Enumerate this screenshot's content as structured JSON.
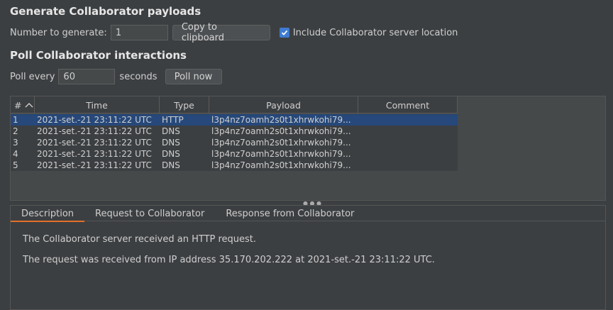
{
  "generate": {
    "title": "Generate Collaborator payloads",
    "number_label": "Number to generate:",
    "number_value": "1",
    "copy_button": "Copy to clipboard",
    "include_label": "Include Collaborator server location",
    "include_checked": true
  },
  "poll": {
    "title": "Poll Collaborator interactions",
    "poll_every_label": "Poll every",
    "poll_value": "60",
    "seconds_label": "seconds",
    "poll_now_button": "Poll now"
  },
  "table": {
    "columns": [
      "#",
      "Time",
      "Type",
      "Payload",
      "Comment"
    ],
    "sort_indicator": "^",
    "rows": [
      {
        "num": "1",
        "time": "2021-set.-21 23:11:22 UTC",
        "type": "HTTP",
        "payload": "l3p4nz7oamh2s0t1xhrwkohi79...",
        "comment": ""
      },
      {
        "num": "2",
        "time": "2021-set.-21 23:11:22 UTC",
        "type": "DNS",
        "payload": "l3p4nz7oamh2s0t1xhrwkohi79...",
        "comment": ""
      },
      {
        "num": "3",
        "time": "2021-set.-21 23:11:22 UTC",
        "type": "DNS",
        "payload": "l3p4nz7oamh2s0t1xhrwkohi79...",
        "comment": ""
      },
      {
        "num": "4",
        "time": "2021-set.-21 23:11:22 UTC",
        "type": "DNS",
        "payload": "l3p4nz7oamh2s0t1xhrwkohi79...",
        "comment": ""
      },
      {
        "num": "5",
        "time": "2021-set.-21 23:11:22 UTC",
        "type": "DNS",
        "payload": "l3p4nz7oamh2s0t1xhrwkohi79...",
        "comment": ""
      }
    ],
    "selected_row": 0
  },
  "details": {
    "tabs": [
      "Description",
      "Request to Collaborator",
      "Response from Collaborator"
    ],
    "active_tab": 0,
    "line1": "The Collaborator server received an HTTP request.",
    "line2": "The request was received from IP address 35.170.202.222 at 2021-set.-21 23:11:22 UTC."
  },
  "colors": {
    "accent_tab": "#e3702b",
    "checkbox": "#3f7bd1",
    "selected_row": "#26487a"
  }
}
